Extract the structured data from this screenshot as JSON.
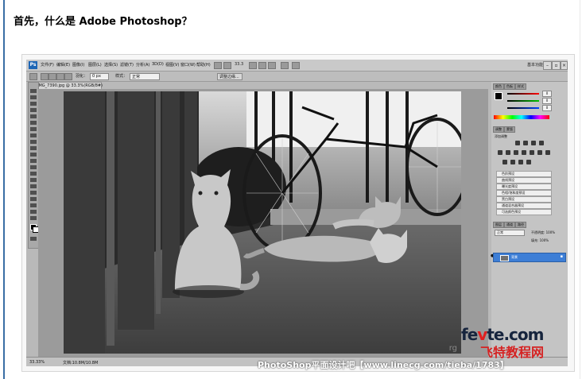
{
  "heading": "首先，什么是 Adobe Photoshop？",
  "photoshop": {
    "logo": "Ps",
    "menus": [
      "文件(F)",
      "编辑(E)",
      "图像(I)",
      "图层(L)",
      "选择(S)",
      "滤镜(T)",
      "分析(A)",
      "3D(D)",
      "视图(V)",
      "窗口(W)",
      "帮助(H)"
    ],
    "zoom_readout": "33.3",
    "workspace_label": "基本功能",
    "options": {
      "feather_label": "羽化：",
      "feather_value": "0 px",
      "style_label": "样式：",
      "style_value": "正常",
      "refine_edge_label": "调整边缘..."
    },
    "document_tab": "IMG_7390.jpg @ 33.3%(RGB/8#)",
    "status": {
      "zoom": "33.33%",
      "doc_size": "文档:10.8M/10.8M"
    },
    "panels": {
      "color_tab": "颜色",
      "swatches_tab": "色板",
      "styles_tab": "样式",
      "color_values": [
        "0",
        "0",
        "0"
      ],
      "adjustments_tab": "调整",
      "masks_tab": "蒙版",
      "adjustments_title": "添加调整",
      "presets": [
        "色阶预设",
        "曲线预设",
        "曝光度预设",
        "色相/饱和度预设",
        "黑白预设",
        "通道混合器预设",
        "可选颜色预设"
      ],
      "layers_tab": "图层",
      "channels_tab": "通道",
      "paths_tab": "路径",
      "blend_mode": "正常",
      "opacity": "不透明度: 100%",
      "fill": "填充: 100%",
      "layer_name": "背景"
    }
  },
  "watermark": {
    "site_a": "fe",
    "site_b": "v",
    "site_c": "te.com",
    "site_cn": "飞特教程网",
    "forum": "PhotoShop平面设计吧【www.linecg.com/tieba/1783】",
    "corner": "rg"
  }
}
